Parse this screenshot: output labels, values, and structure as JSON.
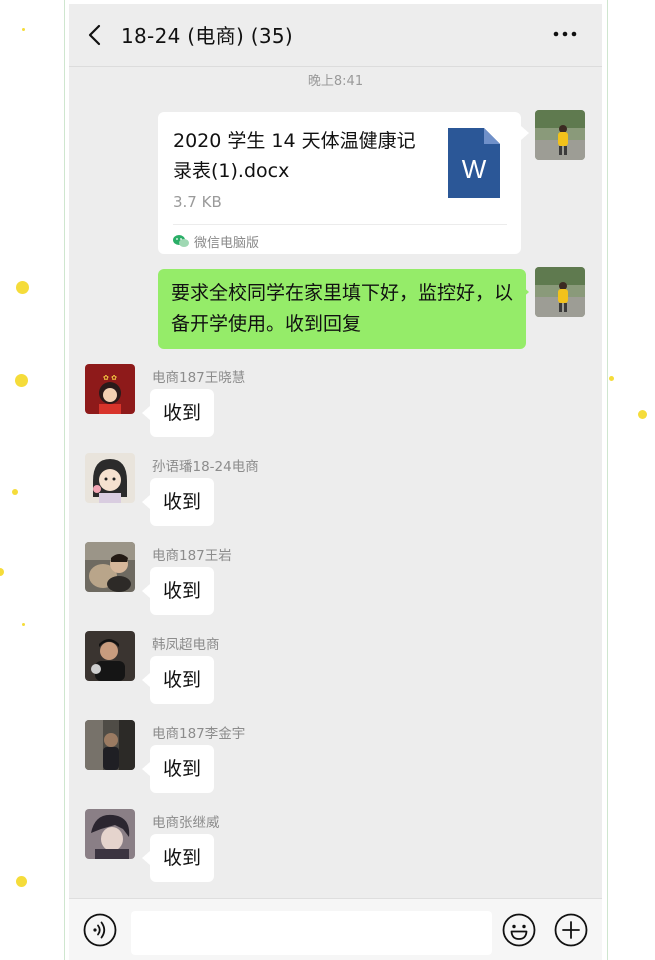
{
  "header": {
    "title": "18-24 (电商) (35)"
  },
  "chat": {
    "timestamp": "晚上8:41",
    "file_message": {
      "file_name": "2020 学生 14 天体温健康记录表(1).docx",
      "file_size": "3.7 KB",
      "file_type_letter": "W",
      "source": "微信电脑版"
    },
    "own_message": {
      "text": "要求全校同学在家里填下好，监控好，以备开学使用。收到回复"
    },
    "replies": [
      {
        "sender": "电商187王晓慧",
        "text": "收到"
      },
      {
        "sender": "孙语璠18-24电商",
        "text": "收到"
      },
      {
        "sender": "电商187王岩",
        "text": "收到"
      },
      {
        "sender": "韩凤超电商",
        "text": "收到"
      },
      {
        "sender": "电商187李金宇",
        "text": "收到"
      },
      {
        "sender": "电商张继威",
        "text": "收到"
      }
    ]
  },
  "input_bar": {
    "placeholder": "",
    "icons": [
      "voice-icon",
      "emoji-icon",
      "plus-icon"
    ]
  },
  "colors": {
    "chat_background": "#ededed",
    "own_bubble": "#95ec69",
    "other_bubble": "#ffffff",
    "word_blue": "#2b5797",
    "decor_dot": "#f5dc3a"
  }
}
